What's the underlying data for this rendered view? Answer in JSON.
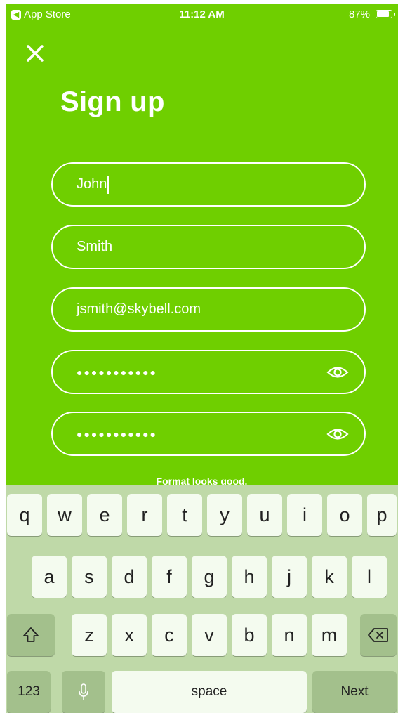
{
  "status_bar": {
    "back_label": "App Store",
    "time": "11:12 AM",
    "battery": "87%",
    "battery_level": 0.87
  },
  "header": {
    "title": "Sign up"
  },
  "form": {
    "first_name": "John",
    "last_name": "Smith",
    "email": "jsmith@skybell.com",
    "password_mask": "●●●●●●●●●●●",
    "confirm_mask": "●●●●●●●●●●●",
    "hint": "Format looks good."
  },
  "keyboard": {
    "row1": [
      "q",
      "w",
      "e",
      "r",
      "t",
      "y",
      "u",
      "i",
      "o",
      "p"
    ],
    "row2": [
      "a",
      "s",
      "d",
      "f",
      "g",
      "h",
      "j",
      "k",
      "l"
    ],
    "row3": [
      "z",
      "x",
      "c",
      "v",
      "b",
      "n",
      "m"
    ],
    "numbers_label": "123",
    "space_label": "space",
    "next_label": "Next"
  },
  "icons": {
    "close": "close-icon",
    "eye": "eye-icon",
    "shift": "shift-icon",
    "backspace": "backspace-icon",
    "mic": "microphone-icon",
    "back": "back-arrow-icon"
  },
  "colors": {
    "brand_green": "#6fcf00",
    "keyboard_bg": "#bfd9a8",
    "key_bg": "#f4fbef",
    "key_dark": "#a3c08c"
  }
}
